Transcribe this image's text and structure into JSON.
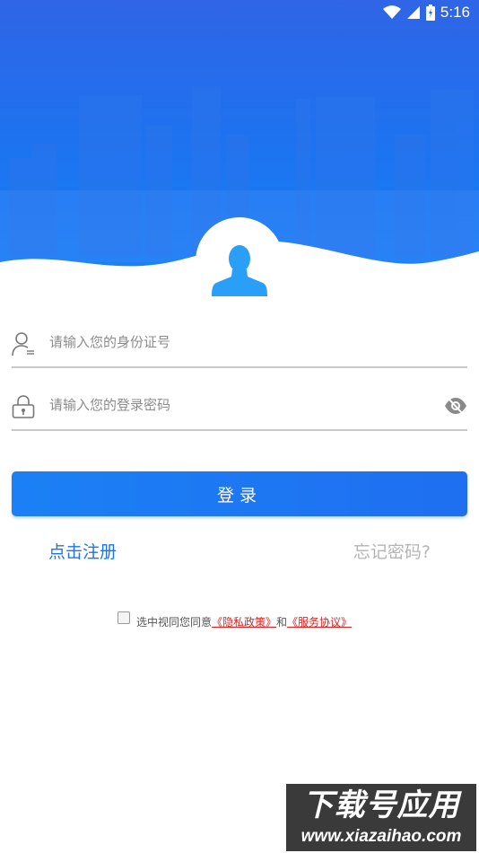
{
  "status_bar": {
    "time": "5:16",
    "icons": [
      "wifi-icon",
      "signal-icon",
      "battery-icon"
    ]
  },
  "colors": {
    "accent": "#1d74e8",
    "header_top": "#2f65e6",
    "header_bottom": "#1b83f6",
    "link_policy": "#e02020",
    "muted": "#b4b4b4"
  },
  "form": {
    "id_placeholder": "请输入您的身份证号",
    "password_placeholder": "请输入您的登录密码",
    "id_icon": "user-id-icon",
    "password_icon": "lock-icon",
    "visibility_icon": "eye-icon"
  },
  "actions": {
    "login": "登录",
    "register": "点击注册",
    "forgot": "忘记密码?"
  },
  "agreement": {
    "prefix": "选中视同您同意",
    "privacy": "《隐私政策》",
    "connector": "和",
    "service": "《服务协议》",
    "checked": false
  },
  "watermark": {
    "title": "下载号应用",
    "url": "www.xiazaihao.com"
  }
}
